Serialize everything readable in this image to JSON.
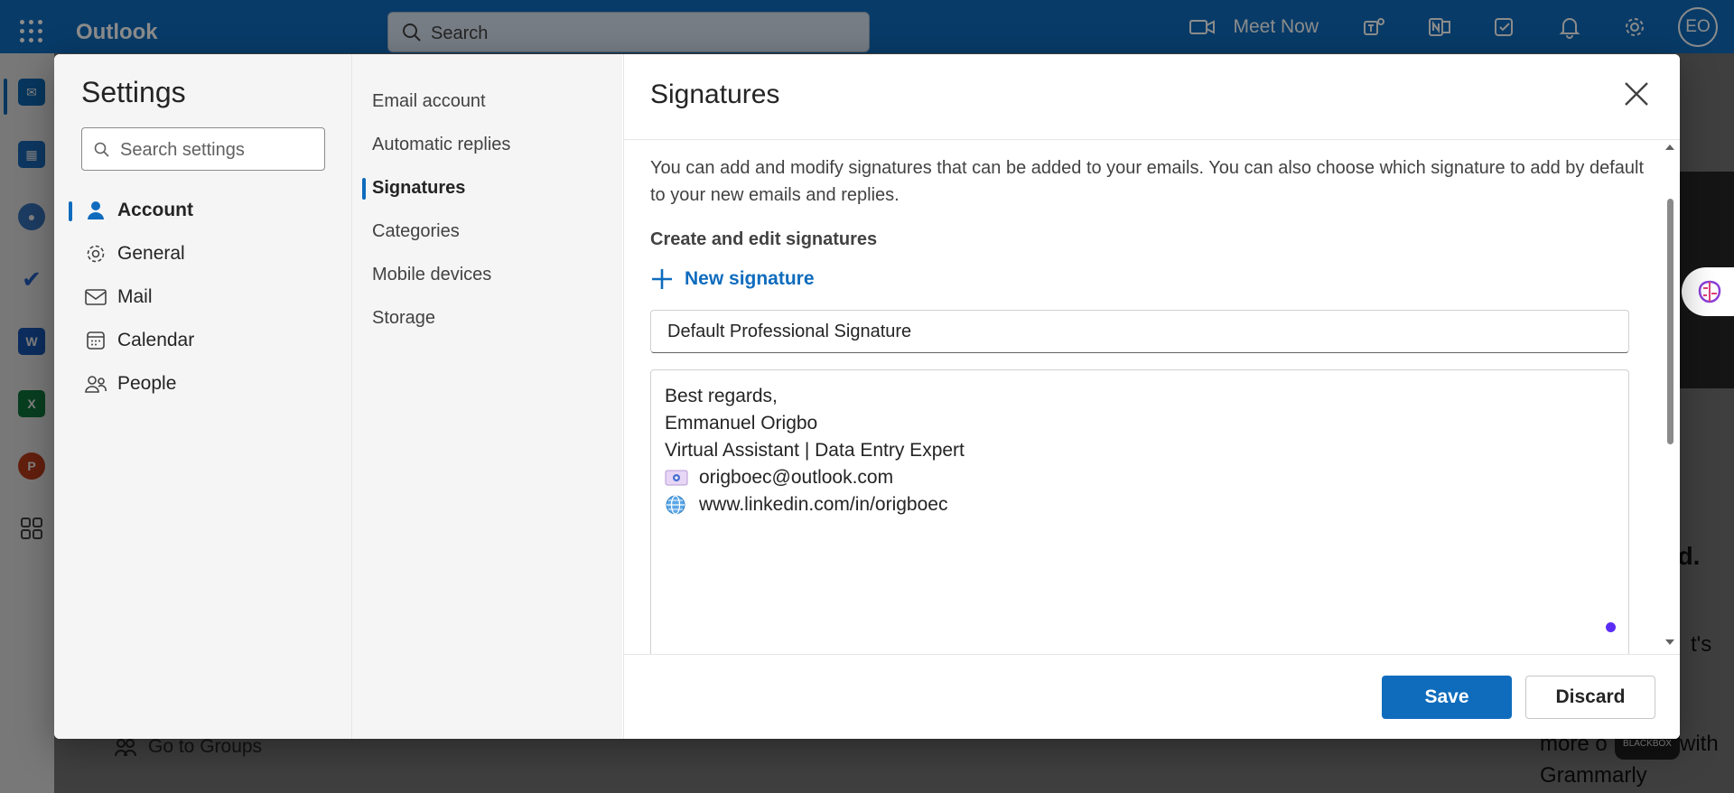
{
  "app": {
    "name": "Outlook"
  },
  "topbar": {
    "search_placeholder": "Search",
    "meet_now_label": "Meet Now",
    "avatar_initials": "EO",
    "icons": [
      "waffle-icon",
      "search-icon",
      "video-icon",
      "teams-icon",
      "onenote-icon",
      "todo-icon",
      "bell-icon",
      "gear-icon"
    ]
  },
  "rail": {
    "apps": [
      "mail",
      "calendar",
      "people",
      "to-do",
      "word",
      "excel",
      "powerpoint",
      "more-apps"
    ],
    "word_letter": "W",
    "excel_letter": "X",
    "powerpoint_letter": "P"
  },
  "background": {
    "go_to_groups": "Go to Groups",
    "right_texts": [
      "ed.",
      "t's",
      "more o",
      "with",
      "Grammarly"
    ],
    "blackbox_label": "BLACKBOX"
  },
  "settings": {
    "title": "Settings",
    "search_placeholder": "Search settings",
    "categories": [
      {
        "label": "Account",
        "icon": "person-icon",
        "active": true
      },
      {
        "label": "General",
        "icon": "gear-icon",
        "active": false
      },
      {
        "label": "Mail",
        "icon": "mail-icon",
        "active": false
      },
      {
        "label": "Calendar",
        "icon": "calendar-icon",
        "active": false
      },
      {
        "label": "People",
        "icon": "people-icon",
        "active": false
      }
    ],
    "subcategories": [
      {
        "label": "Email account",
        "active": false
      },
      {
        "label": "Automatic replies",
        "active": false
      },
      {
        "label": "Signatures",
        "active": true
      },
      {
        "label": "Categories",
        "active": false
      },
      {
        "label": "Mobile devices",
        "active": false
      },
      {
        "label": "Storage",
        "active": false
      }
    ]
  },
  "signatures": {
    "title": "Signatures",
    "description": "You can add and modify signatures that can be added to your emails. You can also choose which signature to add by default to your new emails and replies.",
    "section_heading": "Create and edit signatures",
    "new_signature_label": "New signature",
    "signature_name": "Default Professional Signature",
    "body": {
      "line1": "Best regards,",
      "line2": "Emmanuel Origbo",
      "line3": "Virtual Assistant | Data Entry Expert",
      "email": "origboec@outlook.com",
      "website": "www.linkedin.com/in/origboec"
    },
    "save_label": "Save",
    "discard_label": "Discard"
  },
  "colors": {
    "brand": "#0f6cbd",
    "dot": "#5b2cf6"
  }
}
